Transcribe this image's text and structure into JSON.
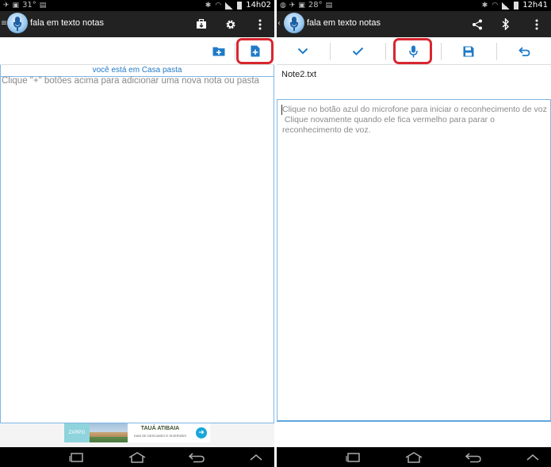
{
  "colors": {
    "action_bar": "#222222",
    "status_bar": "#000000",
    "accent_blue": "#1f7ac8",
    "highlight_red": "#d8262f",
    "hint_gray": "#8a8a8a",
    "divider_blue": "#7fb7e6"
  },
  "left": {
    "status": {
      "temperature": "31°",
      "time": "14h02"
    },
    "app_title": "fala em texto notas",
    "actions": {
      "icons": [
        "briefcase-icon",
        "gear-icon",
        "overflow-menu-icon"
      ]
    },
    "toolbar": {
      "icons": [
        "new-folder-icon",
        "new-note-icon"
      ]
    },
    "location_text": "você está em Casa pasta",
    "hint_text": "Clique \"+\" botões acima para adicionar uma nova nota ou pasta",
    "ad": {
      "logo_text": "ZARPO",
      "title": "TAUÁ ATIBAIA",
      "subtitle": "DIAS DE DESCANSO E DIVERSÃO!"
    }
  },
  "right": {
    "status": {
      "temperature": "28°",
      "time": "12h41"
    },
    "app_title": "fala em texto notas",
    "actions": {
      "icons": [
        "share-icon",
        "bluetooth-icon",
        "overflow-menu-icon"
      ]
    },
    "toolbar": {
      "icons": [
        "chevron-down-icon",
        "check-icon",
        "microphone-icon",
        "save-icon",
        "undo-icon"
      ]
    },
    "filename": "Note2.txt",
    "editor_hint": "Clique no botão azul do microfone para iniciar o reconhecimento de voz\n Clique novamente quando ele fica vermelho para parar o reconhecimento de voz."
  },
  "navbar": {
    "icons": [
      "recent-apps-icon",
      "home-icon",
      "back-icon",
      "up-icon"
    ]
  }
}
